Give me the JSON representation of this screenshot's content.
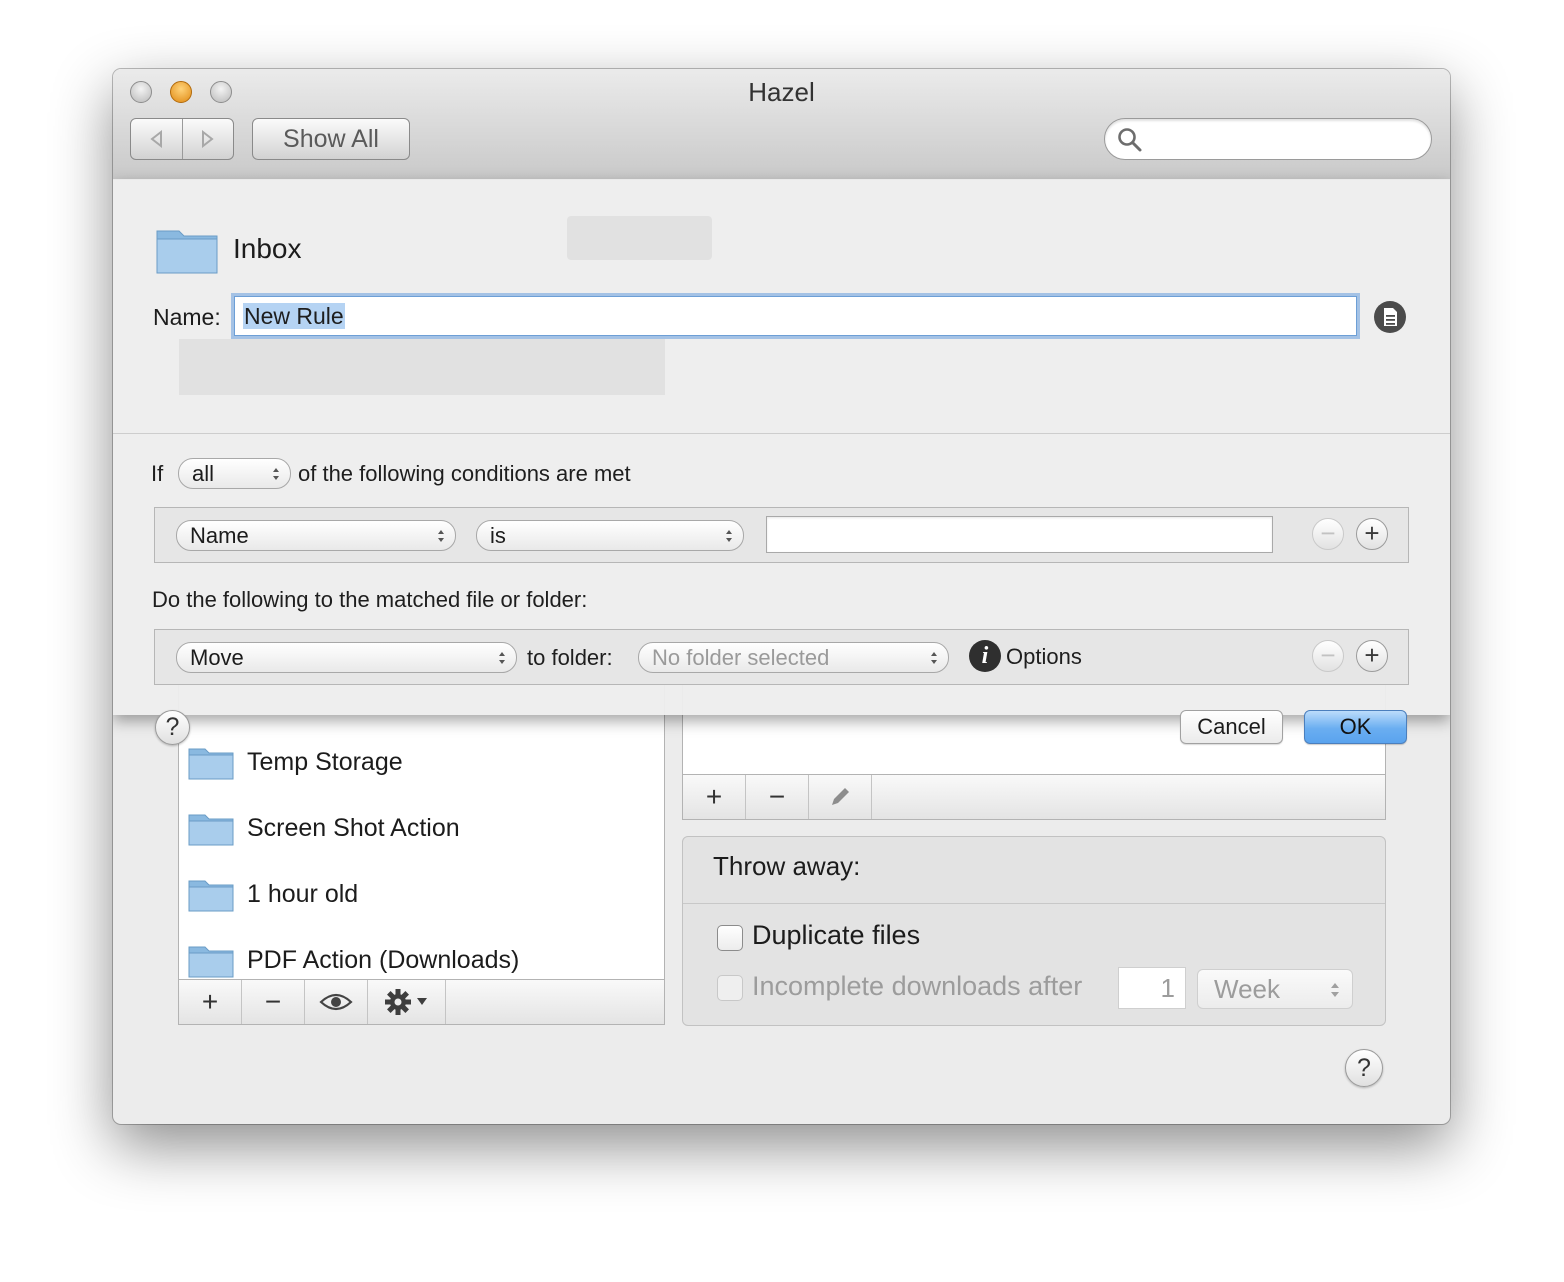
{
  "window": {
    "title": "Hazel"
  },
  "toolbar": {
    "back_icon": "back-arrow-icon",
    "forward_icon": "forward-arrow-icon",
    "show_all_label": "Show All",
    "search_placeholder": "",
    "search_icon": "magnifier-icon"
  },
  "folders": {
    "items": [
      {
        "label": "Temp Storage",
        "icon": "folder-icon"
      },
      {
        "label": "Screen Shot Action",
        "icon": "folder-icon"
      },
      {
        "label": "1 hour old",
        "icon": "folder-icon"
      },
      {
        "label": "PDF Action (Downloads)",
        "icon": "folder-icon"
      }
    ],
    "toolbar": {
      "add": "+",
      "remove": "−",
      "preview_icon": "eye-icon",
      "settings_icon": "gear-icon"
    }
  },
  "rules": {
    "toolbar": {
      "add": "+",
      "remove": "−",
      "edit_icon": "pencil-icon"
    }
  },
  "throw_away": {
    "title": "Throw away:",
    "duplicate_label": "Duplicate files",
    "incomplete_label": "Incomplete downloads after",
    "incomplete_value": "1",
    "incomplete_unit": "Week"
  },
  "sheet": {
    "folder_name": "Inbox",
    "name_label": "Name:",
    "name_value": "New Rule",
    "if_label": "If",
    "match_mode": "all",
    "conditions_text": "of the following conditions are met",
    "condition": {
      "attribute": "Name",
      "operator": "is",
      "value": ""
    },
    "actions_text": "Do the following to the matched file or folder:",
    "action": {
      "type": "Move",
      "to_folder_label": "to folder:",
      "folder": "No folder selected",
      "options_label": "Options"
    },
    "cancel_label": "Cancel",
    "ok_label": "OK",
    "help_label": "?"
  },
  "help_label": "?",
  "colors": {
    "accent": "#6aaef1",
    "folder": "#8ab9e0",
    "focus_ring": "#689ede"
  }
}
